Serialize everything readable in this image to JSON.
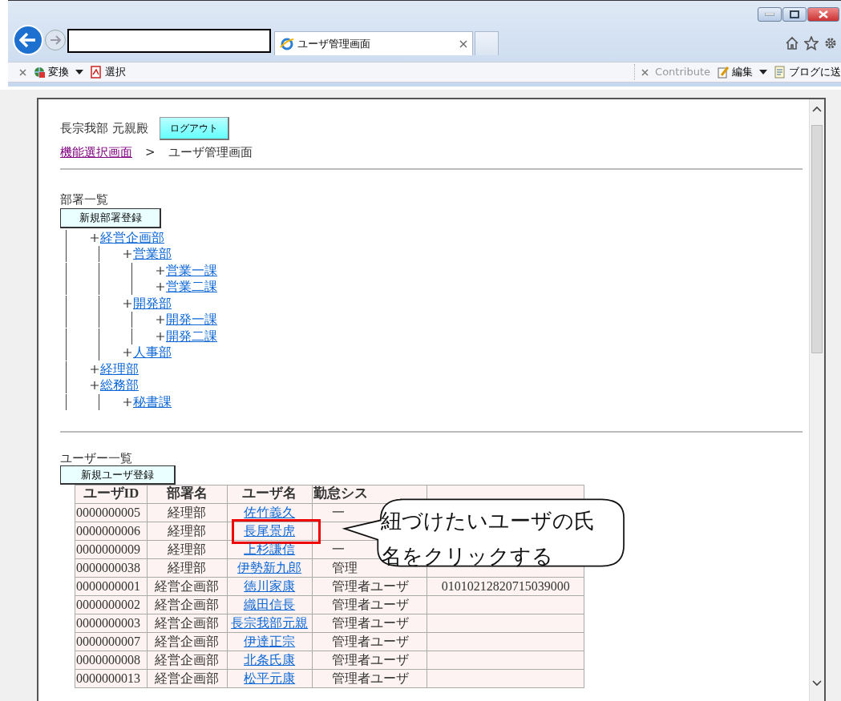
{
  "browser": {
    "tab": {
      "title": "ユーザ管理画面"
    },
    "toolbar_left": [
      {
        "kind": "globe",
        "label": "変換",
        "dropdown": true,
        "disabled": false
      },
      {
        "kind": "pdf",
        "label": "選択",
        "dropdown": false,
        "disabled": false
      }
    ],
    "toolbar_right": [
      {
        "kind": "none",
        "label": "Contribute",
        "dropdown": false,
        "disabled": true
      },
      {
        "kind": "pencil",
        "label": "編集",
        "dropdown": true,
        "disabled": false
      },
      {
        "kind": "page",
        "label": "ブログに送",
        "dropdown": false,
        "disabled": false
      }
    ]
  },
  "header": {
    "user": "長宗我部  元親殿",
    "logout_button": "ログアウト",
    "breadcrumb": [
      {
        "kind": "link",
        "label": "機能選択画面"
      },
      {
        "kind": "separator",
        "label": ">"
      },
      {
        "kind": "text",
        "label": "ユーザ管理画面"
      }
    ]
  },
  "departments": {
    "title": "部署一覧",
    "add_button": "新規部署登録",
    "tree": [
      {
        "label": "経営企画部",
        "children": [
          {
            "label": "営業部",
            "children": [
              {
                "label": "営業一課"
              },
              {
                "label": "営業二課"
              }
            ]
          },
          {
            "label": "開発部",
            "children": [
              {
                "label": "開発一課"
              },
              {
                "label": "開発二課"
              }
            ]
          },
          {
            "label": "人事部"
          }
        ]
      },
      {
        "label": "経理部"
      },
      {
        "label": "総務部",
        "children": [
          {
            "label": "秘書課"
          }
        ]
      }
    ]
  },
  "users": {
    "title": "ユーザー一覧",
    "add_button": "新規ユーザ登録",
    "columns": [
      "ユーザID",
      "部署名",
      "ユーザ名",
      "勤怠シス"
    ],
    "rows": [
      {
        "id": "0000000005",
        "department": "経理部",
        "name": "佐竹義久",
        "role": "一",
        "highlighted": false
      },
      {
        "id": "0000000006",
        "department": "経理部",
        "name": "長尾景虎",
        "highlighted": true
      },
      {
        "id": "0000000009",
        "department": "経理部",
        "name": "上杉謙信",
        "role": "一",
        "highlighted": false
      },
      {
        "id": "0000000038",
        "department": "経理部",
        "name": "伊勢新九郎",
        "role": "管理",
        "highlighted": false
      },
      {
        "id": "0000000001",
        "department": "経営企画部",
        "name": "徳川家康",
        "role": "管理者ユーザ",
        "column_5": "01010212820715039000",
        "highlighted": false
      },
      {
        "id": "0000000002",
        "department": "経営企画部",
        "name": "織田信長",
        "role": "管理者ユーザ",
        "highlighted": false
      },
      {
        "id": "0000000003",
        "department": "経営企画部",
        "name": "長宗我部元親",
        "role": "管理者ユーザ",
        "highlighted": false
      },
      {
        "id": "0000000007",
        "department": "経営企画部",
        "name": "伊達正宗",
        "role": "管理者ユーザ",
        "highlighted": false
      },
      {
        "id": "0000000008",
        "department": "経営企画部",
        "name": "北条氏康",
        "role": "管理者ユーザ",
        "highlighted": false
      },
      {
        "id": "0000000013",
        "department": "経営企画部",
        "name": "松平元康",
        "role": "管理者ユーザ",
        "highlighted": false
      }
    ]
  },
  "callout": {
    "lines": [
      "紐づけたいユーザの氏",
      "名をクリックする"
    ]
  }
}
